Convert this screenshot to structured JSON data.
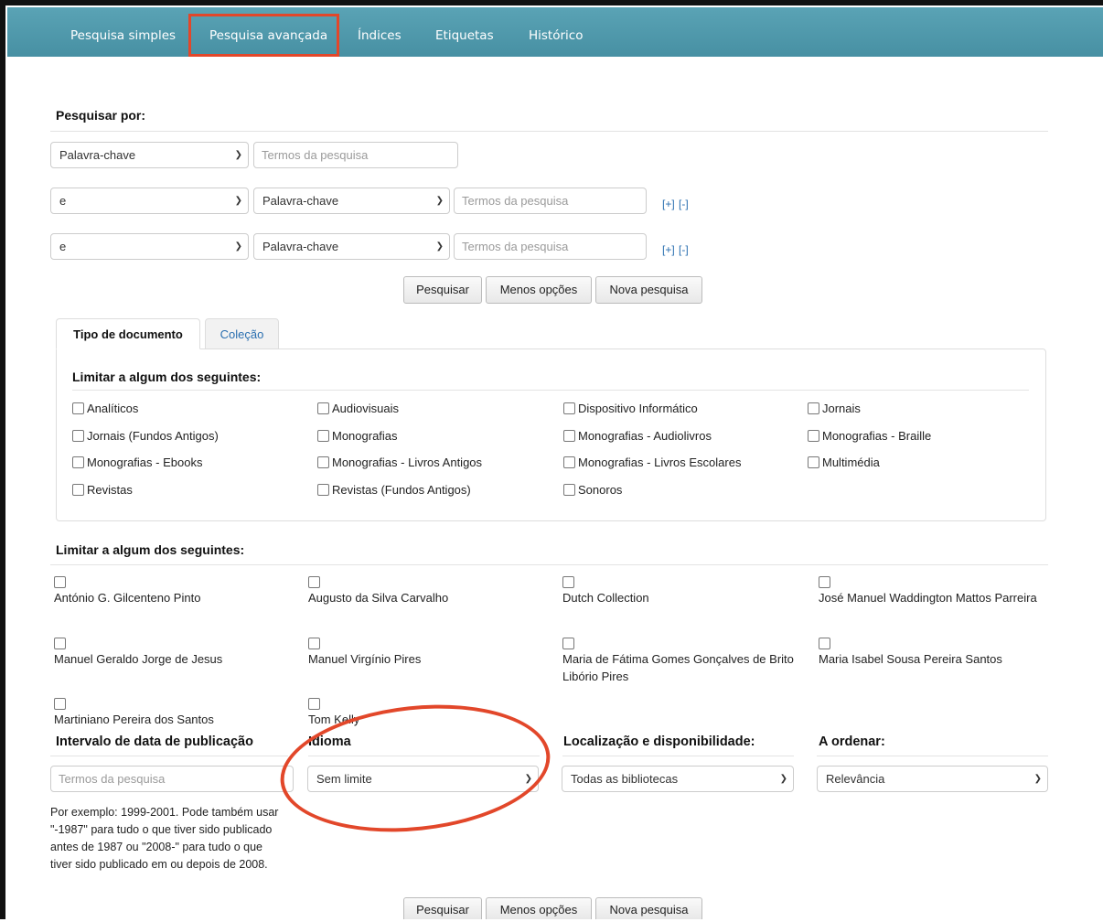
{
  "nav": {
    "items": [
      "Pesquisa simples",
      "Pesquisa avançada",
      "Índices",
      "Etiquetas",
      "Histórico"
    ],
    "active": "Pesquisa avançada"
  },
  "search": {
    "title": "Pesquisar por:",
    "rows": [
      {
        "field": "Palavra-chave",
        "placeholder": "Termos da pesquisa"
      },
      {
        "operator": "e",
        "field": "Palavra-chave",
        "placeholder": "Termos da pesquisa",
        "add": "[+]",
        "remove": "[-]"
      },
      {
        "operator": "e",
        "field": "Palavra-chave",
        "placeholder": "Termos da pesquisa",
        "add": "[+]",
        "remove": "[-]"
      }
    ],
    "buttons": {
      "search": "Pesquisar",
      "fewer": "Menos opções",
      "new": "Nova pesquisa"
    }
  },
  "tabs": {
    "items": [
      "Tipo de documento",
      "Coleção"
    ],
    "active": "Tipo de documento"
  },
  "doctype": {
    "title": "Limitar a algum dos seguintes:",
    "options": [
      "Analíticos",
      "Audiovisuais",
      "Dispositivo Informático",
      "Jornais",
      "Jornais (Fundos Antigos)",
      "Monografias",
      "Monografias - Audiolivros",
      "Monografias - Braille",
      "Monografias - Ebooks",
      "Monografias - Livros Antigos",
      "Monografias - Livros Escolares",
      "Multimédia",
      "Revistas",
      "Revistas (Fundos Antigos)",
      "Sonoros"
    ]
  },
  "collections": {
    "title": "Limitar a algum dos seguintes:",
    "items": [
      "António G. Gilcenteno Pinto",
      "Augusto da Silva Carvalho",
      "Dutch Collection",
      "José Manuel Waddington Mattos Parreira",
      "Manuel Geraldo Jorge de Jesus",
      "Manuel Virgínio Pires",
      "Maria de Fátima Gomes Gonçalves de Brito Libório Pires",
      "Maria Isabel Sousa Pereira Santos",
      "Martiniano Pereira dos Santos",
      "Tom Kelly"
    ]
  },
  "filters": {
    "date": {
      "title": "Intervalo de data de publicação",
      "placeholder": "Termos da pesquisa",
      "hint": "Por exemplo: 1999-2001. Pode também usar \"-1987\" para tudo o que tiver sido publicado antes de 1987 ou \"2008-\" para tudo o que tiver sido publicado em ou depois de 2008."
    },
    "language": {
      "title": "Idioma",
      "value": "Sem limite"
    },
    "location": {
      "title": "Localização e disponibilidade:",
      "value": "Todas as bibliotecas"
    },
    "sort": {
      "title": "A ordenar:",
      "value": "Relevância"
    }
  },
  "colors": {
    "navbar": "#4f99ac",
    "highlight": "#e2472a",
    "link": "#2a6fb0"
  }
}
